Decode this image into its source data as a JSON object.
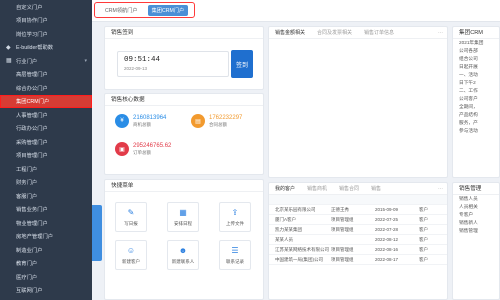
{
  "sidebar": {
    "items": [
      {
        "label": "自定义门户",
        "icon": "",
        "sub": true
      },
      {
        "label": "项目协作门户",
        "icon": "",
        "sub": true
      },
      {
        "label": "岗位学习门户",
        "icon": "",
        "sub": true
      },
      {
        "label": "E-builder帮助数",
        "icon": "cube-icon",
        "sub": false
      },
      {
        "label": "行业门户",
        "icon": "grid-icon",
        "sub": false,
        "arrow": "▾"
      },
      {
        "label": "高层管理门户",
        "icon": "",
        "sub": true
      },
      {
        "label": "综合办公门户",
        "icon": "",
        "sub": true
      },
      {
        "label": "集团CRM门户",
        "icon": "",
        "sub": true,
        "active": true
      },
      {
        "label": "人事管理门户",
        "icon": "",
        "sub": true
      },
      {
        "label": "行政办公门户",
        "icon": "",
        "sub": true
      },
      {
        "label": "采购管理门户",
        "icon": "",
        "sub": true
      },
      {
        "label": "项目管理门户",
        "icon": "",
        "sub": true
      },
      {
        "label": "工程门户",
        "icon": "",
        "sub": true
      },
      {
        "label": "财务门户",
        "icon": "",
        "sub": true
      },
      {
        "label": "客服门户",
        "icon": "",
        "sub": true
      },
      {
        "label": "销售业务门户",
        "icon": "",
        "sub": true
      },
      {
        "label": "物业管理门户",
        "icon": "",
        "sub": true
      },
      {
        "label": "房地产管理门户",
        "icon": "",
        "sub": true
      },
      {
        "label": "制造业门户",
        "icon": "",
        "sub": true
      },
      {
        "label": "教育门户",
        "icon": "",
        "sub": true
      },
      {
        "label": "医疗门户",
        "icon": "",
        "sub": true
      },
      {
        "label": "互联网门户",
        "icon": "",
        "sub": true
      }
    ]
  },
  "tabs": [
    {
      "label": "CRM领航门户",
      "active": false
    },
    {
      "label": "集团CRM门户",
      "active": true
    }
  ],
  "checkin": {
    "title": "销售签到",
    "time": "09:51:44",
    "date": "2022-09-13",
    "button": "签到"
  },
  "core": {
    "title": "销售核心数据",
    "metrics": [
      {
        "value": "2160813964",
        "label": "商机总额",
        "color": "#2a8de6",
        "icon": "coin-icon"
      },
      {
        "value": "1762232297",
        "label": "合同总额",
        "color": "#f29a2e",
        "icon": "contract-icon"
      },
      {
        "value": "295246765.62",
        "label": "订单总额",
        "color": "#e23b49",
        "icon": "order-icon"
      }
    ]
  },
  "shortcuts": {
    "title": "快捷菜单",
    "items": [
      {
        "label": "写日报",
        "icon": "edit-icon",
        "glyph": "✎"
      },
      {
        "label": "安排日程",
        "icon": "calendar-icon",
        "glyph": "▦"
      },
      {
        "label": "上传文件",
        "icon": "upload-icon",
        "glyph": "⇪"
      },
      {
        "label": "新建客户",
        "icon": "add-customer-icon",
        "glyph": "☺"
      },
      {
        "label": "新建联系人",
        "icon": "add-contact-icon",
        "glyph": "☻"
      },
      {
        "label": "联系记录",
        "icon": "record-icon",
        "glyph": "☰"
      }
    ]
  },
  "leads": {
    "tabs": [
      "销售金额相关",
      "合同及发票相关",
      "销售订单信息"
    ]
  },
  "customers": {
    "tabs": [
      "我的客户",
      "销售商机",
      "销售合同",
      "销售"
    ],
    "rows": [
      [
        "北京某乐园有限公司",
        "正德王秀",
        "2015-09-09",
        "客户"
      ],
      [
        "厦门A客户",
        "项目管理组",
        "2022-07-25",
        "客户"
      ],
      [
        "凯力某某集团",
        "项目管理组",
        "2022-07-28",
        "客户"
      ],
      [
        "某某人员",
        "",
        "2022-08-12",
        "客户"
      ],
      [
        "江苏某某网络技术有限公司",
        "项目管理组",
        "2022-08-16",
        "客户"
      ],
      [
        "中国建筑一局(集团)公司",
        "项目管理组",
        "2022-08-17",
        "客户"
      ]
    ]
  },
  "news": {
    "title": "集团CRM",
    "lines": [
      "2021年集团",
      "",
      "公司各部",
      "组合公司",
      "日起开展",
      "一、活动",
      "日下午2",
      "",
      "二、工作",
      "公司客户",
      "全期间，",
      "产品结构",
      "服务，产",
      "参与活动"
    ]
  },
  "biz": {
    "title": "销售管理",
    "lines": [
      "销售人员",
      "人员相关",
      "专客户",
      "销售新人",
      "销售管理"
    ]
  }
}
